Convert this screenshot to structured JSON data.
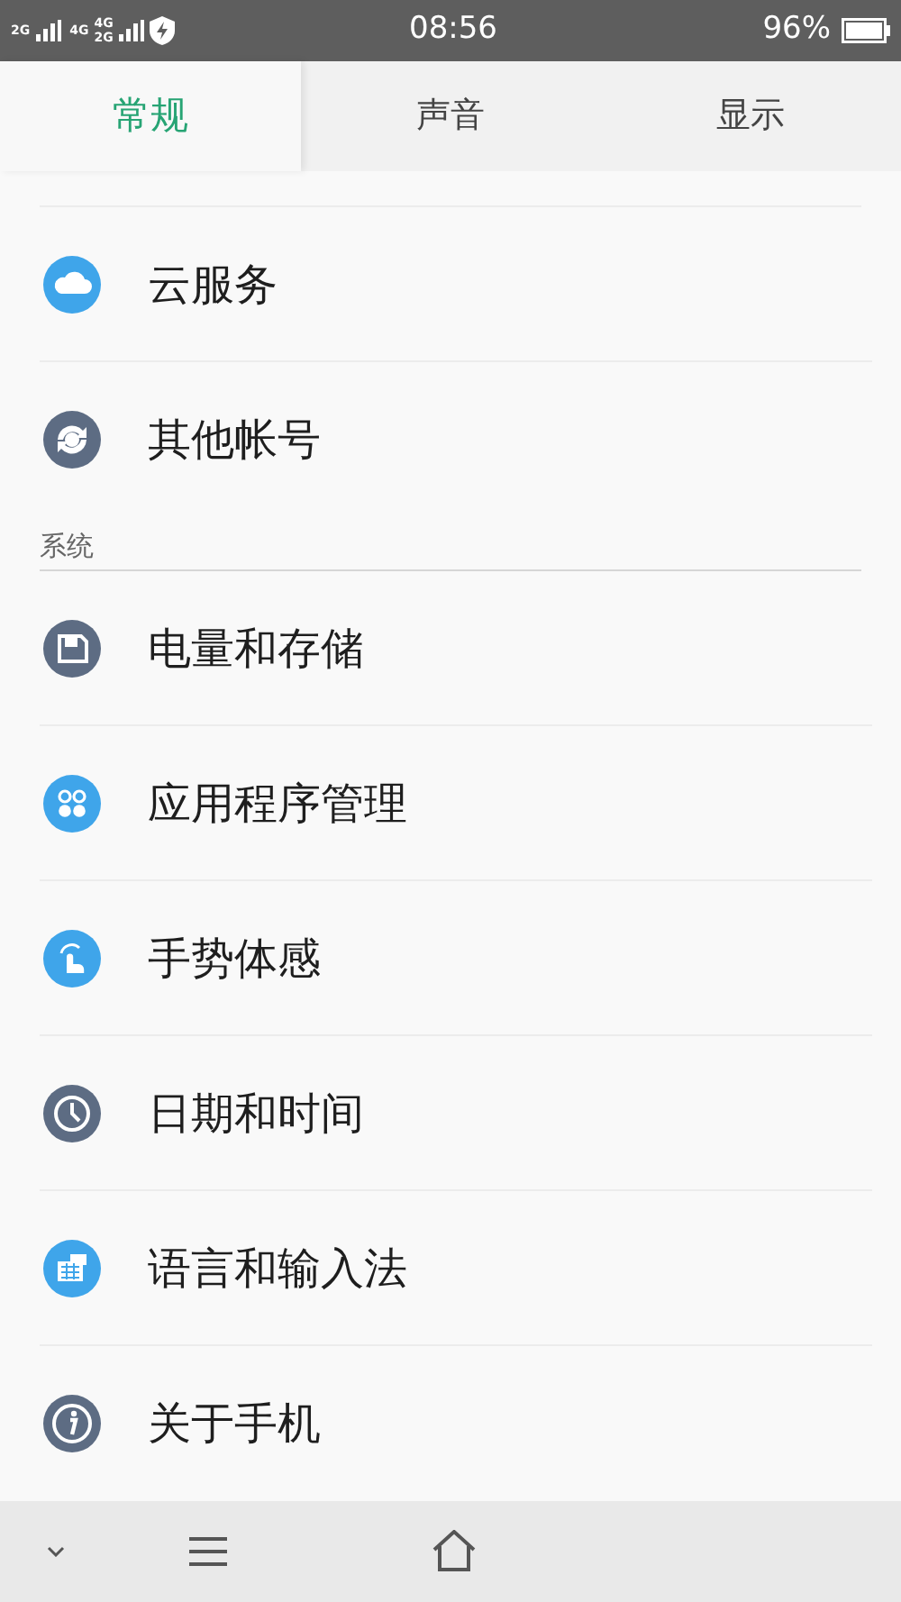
{
  "status_bar": {
    "network_labels": [
      "2G",
      "4G",
      "4G",
      "2G"
    ],
    "time": "08:56",
    "battery": "96%"
  },
  "tabs": [
    {
      "label": "常规",
      "selected": true
    },
    {
      "label": "声音",
      "selected": false
    },
    {
      "label": "显示",
      "selected": false
    }
  ],
  "sections": [
    {
      "items": [
        {
          "label": "云服务",
          "kind": "cloud",
          "color": "#3fa5ea"
        },
        {
          "label": "其他帐号",
          "kind": "sync",
          "color": "#5d6c83"
        }
      ]
    },
    {
      "header": "系统",
      "items": [
        {
          "label": "电量和存储",
          "kind": "save",
          "color": "#5d6c83"
        },
        {
          "label": "应用程序管理",
          "kind": "apps",
          "color": "#3fa5ea"
        },
        {
          "label": "手势体感",
          "kind": "gesture",
          "color": "#3fa5ea"
        },
        {
          "label": "日期和时间",
          "kind": "clock",
          "color": "#5d6c83"
        },
        {
          "label": "语言和输入法",
          "kind": "keyboard",
          "color": "#3fa5ea"
        },
        {
          "label": "关于手机",
          "kind": "info",
          "color": "#5d6c83"
        }
      ]
    }
  ]
}
